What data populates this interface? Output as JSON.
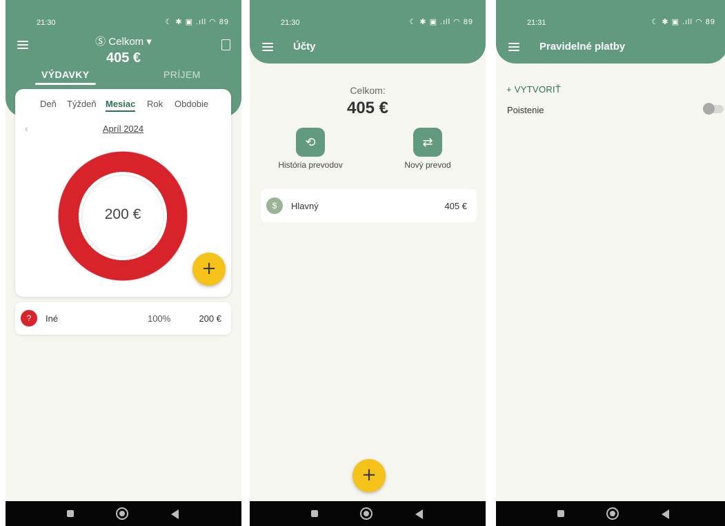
{
  "screens": [
    {
      "status_time": "21:30",
      "status_icons": "☾ ✱ ▣ .ıll ◠ 89",
      "account_name": "Celkom",
      "total": "405 €",
      "tabs": [
        "VÝDAVKY",
        "PRÍJEM"
      ],
      "periods": [
        "Deň",
        "Týždeň",
        "Mesiac",
        "Rok",
        "Obdobie"
      ],
      "month": "Apríl 2024",
      "chart_total": "200 €",
      "categories": [
        {
          "name": "Iné",
          "percent": "100%",
          "amount": "200 €"
        }
      ],
      "colors": {
        "header": "#629a7f",
        "category": "#d9232a",
        "fab": "#f5c21a"
      }
    },
    {
      "status_time": "21:30",
      "status_icons": "☾ ✱ ▣ .ıll ◠ 89",
      "title": "Účty",
      "total_label": "Celkom:",
      "total_value": "405 €",
      "actions": [
        "História prevodov",
        "Nový prevod"
      ],
      "accounts": [
        {
          "name": "Hlavný",
          "amount": "405 €"
        }
      ]
    },
    {
      "status_time": "21:31",
      "status_icons": "☾ ✱ ▣ .ıll ◠ 89",
      "title": "Pravidelné platby",
      "create_label": "+ VYTVORIŤ",
      "items": [
        {
          "name": "Poistenie",
          "enabled": false
        }
      ]
    }
  ]
}
